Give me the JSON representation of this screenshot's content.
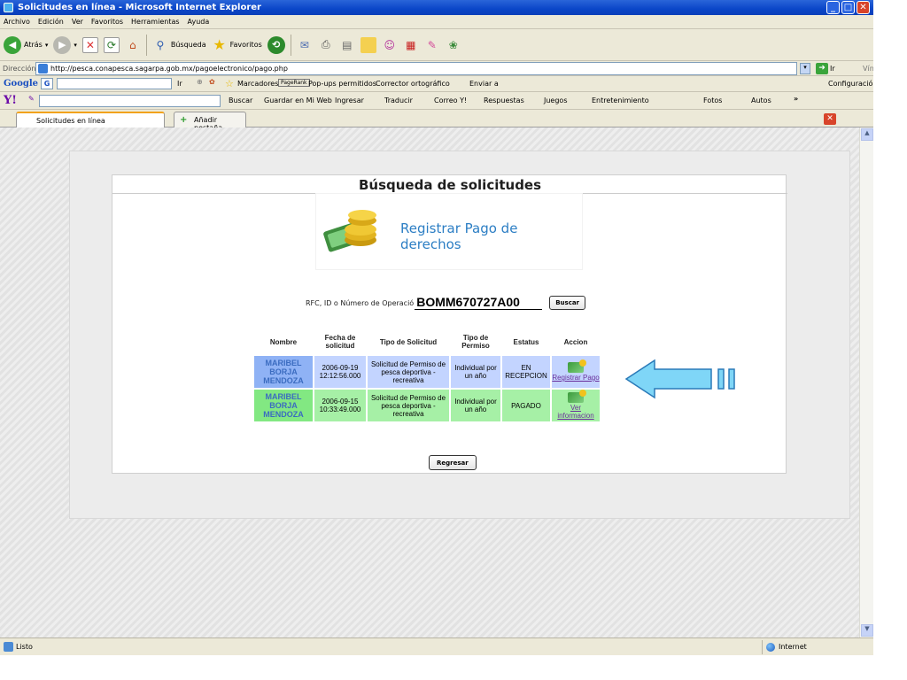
{
  "window": {
    "title": "Solicitudes en línea - Microsoft Internet Explorer"
  },
  "menu": [
    "Archivo",
    "Edición",
    "Ver",
    "Favoritos",
    "Herramientas",
    "Ayuda"
  ],
  "toolbar": {
    "back_label": "Atrás",
    "search_label": "Búsqueda",
    "favorites_label": "Favoritos"
  },
  "address": {
    "label": "Dirección",
    "url": "http://pesca.conapesca.sagarpa.gob.mx/pagoelectronico/pago.php",
    "go_label": "Ir",
    "links_label": "Vínculos"
  },
  "google_bar": {
    "brand": "Google",
    "search_value": "",
    "go_label": "Ir",
    "bookmarks_label": "Marcadores",
    "pagerank_label": "PageRank",
    "popups_label": "Pop-ups permitidos",
    "spell_label": "Corrector ortográfico",
    "send_label": "Enviar a",
    "settings_label": "Configuración"
  },
  "yahoo_bar": {
    "brand": "Y!",
    "search_label": "Buscar",
    "save_label": "Guardar en Mi Web",
    "signin_label": "Ingresar",
    "translate_label": "Traducir",
    "mail_label": "Correo Y!",
    "answers_label": "Respuestas",
    "games_label": "Juegos",
    "entertainment_label": "Entretenimiento",
    "photos_label": "Fotos",
    "autos_label": "Autos"
  },
  "tabs": {
    "active_label": "Solicitudes en línea",
    "add_label": "Añadir pestaña"
  },
  "status": {
    "text": "Listo",
    "zone": "Internet"
  },
  "page": {
    "heading": "Búsqueda de solicitudes",
    "register_payment_title": "Registrar Pago de derechos",
    "search": {
      "label": "RFC, ID o Número de Operació",
      "value": "BOMM670727A00",
      "button": "Buscar"
    },
    "table": {
      "headers": [
        "Nombre",
        "Fecha de solicitud",
        "Tipo de Solicitud",
        "Tipo de Permiso",
        "Estatus",
        "Accion"
      ],
      "rows": [
        {
          "nombre": "MARIBEL BORJA MENDOZA",
          "fecha": "2006-09-19 12:12:56.000",
          "tipo_solicitud": "Solicitud de Permiso de pesca deportiva - recreativa",
          "tipo_permiso": "Individual por un año",
          "estatus": "EN RECEPCION",
          "accion": "Registrar Pago"
        },
        {
          "nombre": "MARIBEL BORJA MENDOZA",
          "fecha": "2006-09-15 10:33:49.000",
          "tipo_solicitud": "Solicitud de Permiso de pesca deportiva - recreativa",
          "tipo_permiso": "Individual por un año",
          "estatus": "PAGADO",
          "accion": "Ver informacion"
        }
      ]
    },
    "back_button": "Regresar"
  },
  "colors": {
    "title_bar": "#0a46c8",
    "row_pending": "#c3d4ff",
    "row_paid": "#a6f0a6",
    "annotation_arrow": "#7fd6f7",
    "link": "#6a2f9a"
  }
}
